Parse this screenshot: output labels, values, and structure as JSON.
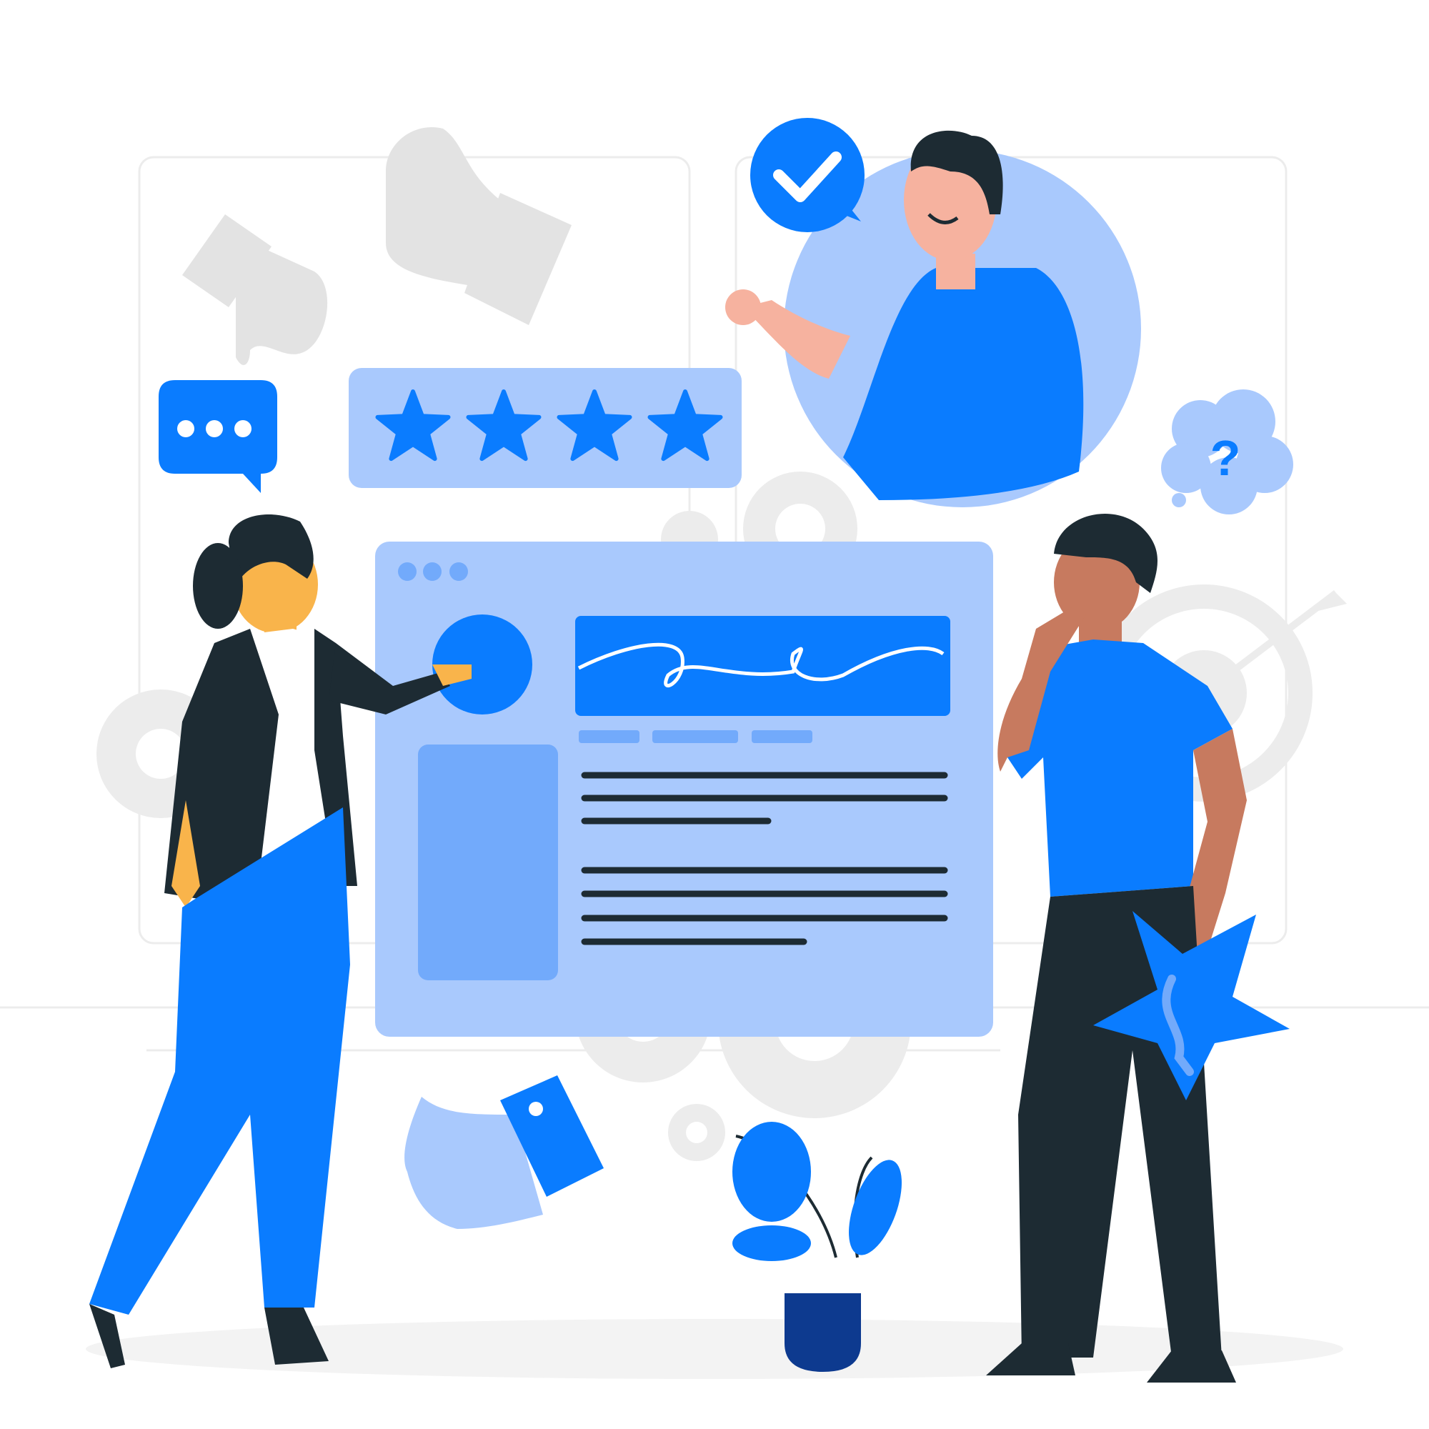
{
  "illustration": {
    "rating_stars": 4,
    "chat_icon": "chat-bubble-ellipsis-icon",
    "check_icon": "checkmark-badge-icon",
    "question_icon": "question-mark-cloud-icon",
    "question_glyph": "?",
    "colors": {
      "primary": "#0a7cff",
      "light": "#a9c9fd",
      "mid": "#72aafb",
      "dark": "#1d2b33",
      "gray": "#ececec",
      "skin_light": "#f6b29f",
      "skin_tan": "#f9b44b",
      "skin_dark": "#c77a5f",
      "pot": "#0d3a8f"
    }
  }
}
